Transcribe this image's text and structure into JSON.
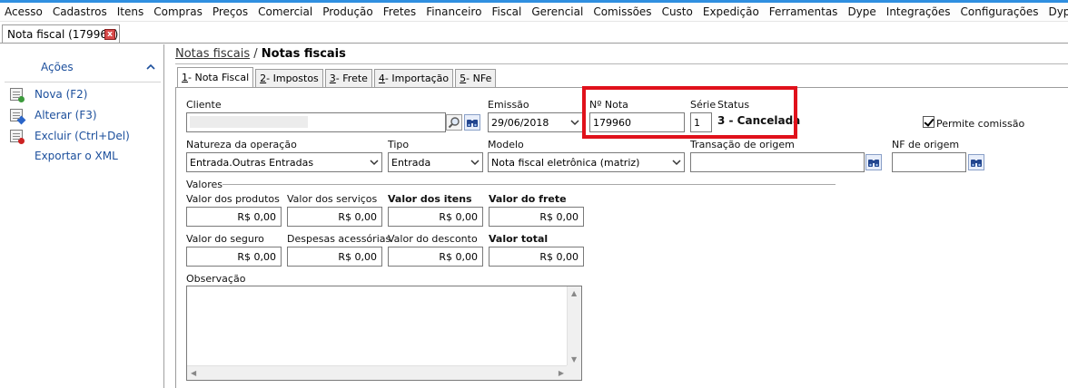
{
  "menu": [
    "Acesso",
    "Cadastros",
    "Itens",
    "Compras",
    "Preços",
    "Comercial",
    "Produção",
    "Fretes",
    "Financeiro",
    "Fiscal",
    "Gerencial",
    "Comissões",
    "Custo",
    "Expedição",
    "Ferramentas",
    "Dype",
    "Integrações",
    "Configurações",
    "Dype Dev"
  ],
  "doc_tab": {
    "title": "Nota fiscal (179960)",
    "close": "x"
  },
  "sidebar": {
    "title": "Ações",
    "collapse_icon": "chevron-up-icon",
    "actions": [
      {
        "label": "Nova (F2)",
        "icon": "new-document-icon"
      },
      {
        "label": "Alterar (F3)",
        "icon": "edit-document-icon"
      },
      {
        "label": "Excluir (Ctrl+Del)",
        "icon": "delete-document-icon"
      },
      {
        "label": "Exportar o XML",
        "icon": ""
      }
    ]
  },
  "breadcrumb": {
    "parent": "Notas fiscais",
    "sep": " / ",
    "current": "Notas fiscais"
  },
  "tabs": [
    {
      "num": "1",
      "label": " - Nota Fiscal"
    },
    {
      "num": "2",
      "label": " - Impostos"
    },
    {
      "num": "3",
      "label": " - Frete"
    },
    {
      "num": "4",
      "label": " - Importação"
    },
    {
      "num": "5",
      "label": " - NFe"
    }
  ],
  "form": {
    "cliente_label": "Cliente",
    "cliente_value": "",
    "emissao_label": "Emissão",
    "emissao_value": "29/06/2018",
    "nota_label": "Nº Nota",
    "nota_value": "179960",
    "serie_label": "Série",
    "serie_value": "1",
    "status_label": "Status",
    "status_value": "3 - Cancelada",
    "permite_label": "Permite comissão",
    "natureza_label": "Natureza da operação",
    "natureza_value": "Entrada.Outras Entradas",
    "tipo_label": "Tipo",
    "tipo_value": "Entrada",
    "modelo_label": "Modelo",
    "modelo_value": "Nota fiscal eletrônica (matriz)",
    "transacao_label": "Transação de origem",
    "transacao_value": "",
    "nf_origem_label": "NF de origem",
    "nf_origem_value": "",
    "valores_label": "Valores",
    "valor_produtos_label": "Valor dos produtos",
    "valor_produtos": "R$ 0,00",
    "valor_servicos_label": "Valor dos serviços",
    "valor_servicos": "R$ 0,00",
    "valor_itens_label": "Valor dos itens",
    "valor_itens": "R$ 0,00",
    "valor_frete_label": "Valor do frete",
    "valor_frete": "R$ 0,00",
    "valor_seguro_label": "Valor do seguro",
    "valor_seguro": "R$ 0,00",
    "despesas_label": "Despesas acessórias",
    "despesas": "R$ 0,00",
    "desconto_label": "Valor do desconto",
    "desconto": "R$ 0,00",
    "total_label": "Valor total",
    "total": "R$ 0,00",
    "observacao_label": "Observação",
    "observacao_value": ""
  },
  "colors": {
    "accent": "#2f8fe0",
    "highlight": "#e0111b",
    "link": "#1c4f9c"
  }
}
